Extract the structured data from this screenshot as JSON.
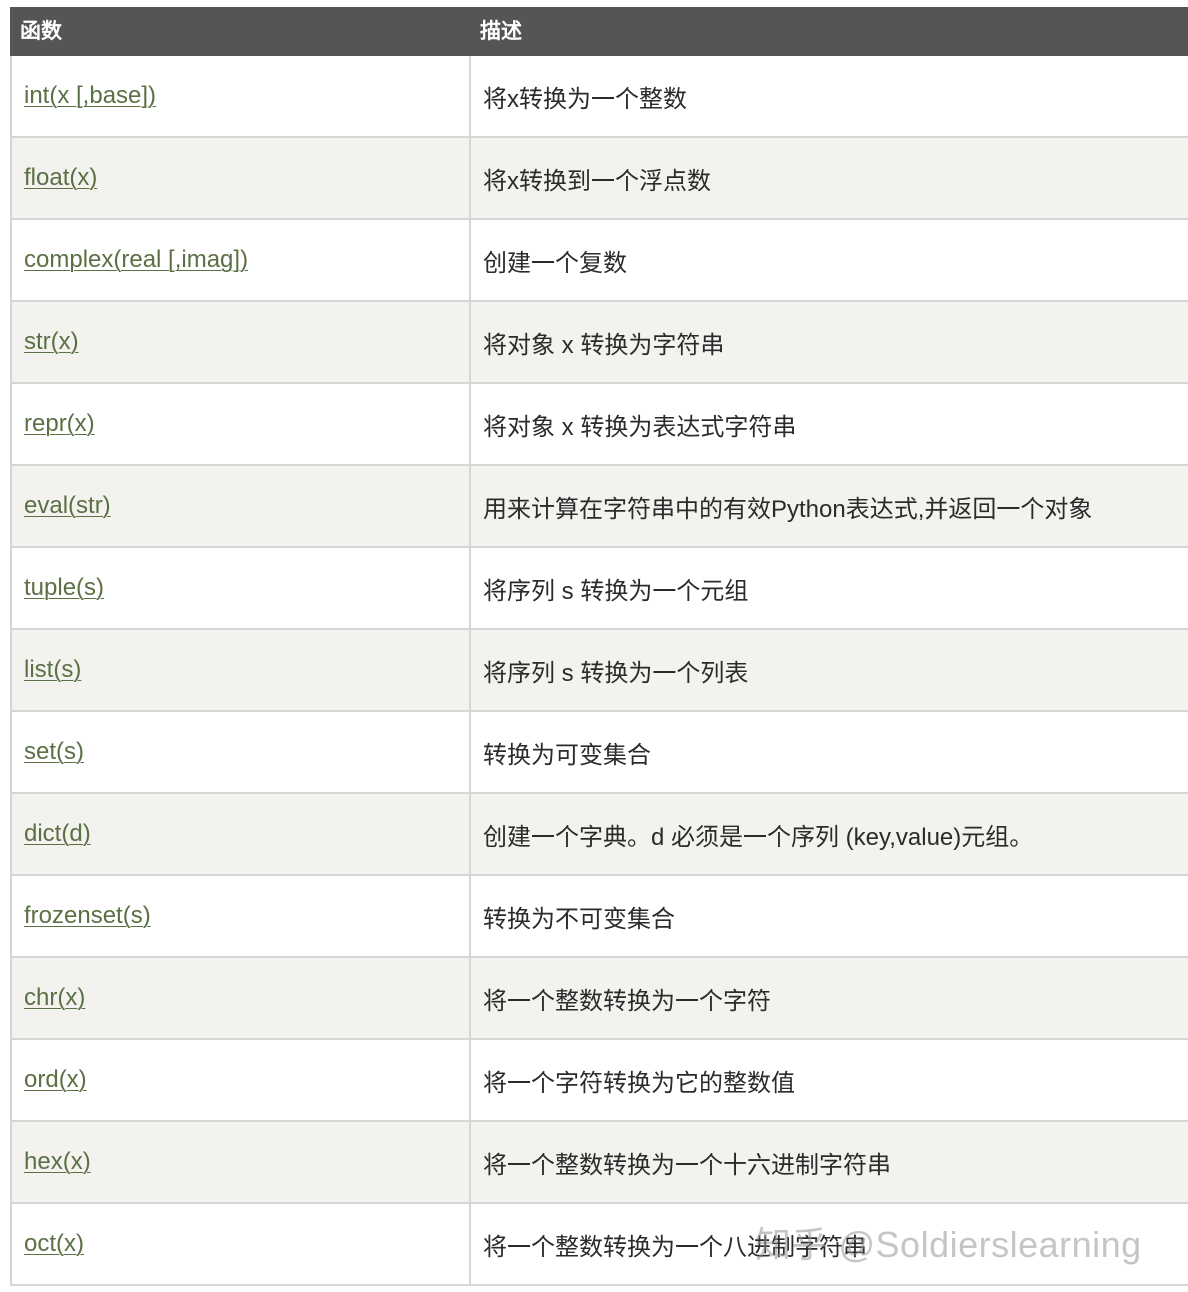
{
  "table": {
    "headers": [
      "函数",
      "描述"
    ],
    "rows": [
      {
        "function": "int(x [,base])",
        "description": "将x转换为一个整数"
      },
      {
        "function": "float(x)",
        "description": "将x转换到一个浮点数"
      },
      {
        "function": "complex(real [,imag])",
        "description": "创建一个复数"
      },
      {
        "function": "str(x)",
        "description": "将对象 x 转换为字符串"
      },
      {
        "function": "repr(x)",
        "description": "将对象 x 转换为表达式字符串"
      },
      {
        "function": "eval(str)",
        "description": "用来计算在字符串中的有效Python表达式,并返回一个对象"
      },
      {
        "function": "tuple(s)",
        "description": "将序列 s 转换为一个元组"
      },
      {
        "function": "list(s)",
        "description": "将序列 s 转换为一个列表"
      },
      {
        "function": "set(s)",
        "description": "转换为可变集合"
      },
      {
        "function": "dict(d)",
        "description": "创建一个字典。d 必须是一个序列 (key,value)元组。"
      },
      {
        "function": "frozenset(s)",
        "description": "转换为不可变集合"
      },
      {
        "function": "chr(x)",
        "description": "将一个整数转换为一个字符"
      },
      {
        "function": "ord(x)",
        "description": "将一个字符转换为它的整数值"
      },
      {
        "function": "hex(x)",
        "description": "将一个整数转换为一个十六进制字符串"
      },
      {
        "function": "oct(x)",
        "description": "将一个整数转换为一个八进制字符串"
      }
    ]
  },
  "watermark": "知乎 @Soldierslearning",
  "colors": {
    "header_bg": "#555555",
    "link": "#5b7043",
    "alt_row": "#f3f2ef"
  }
}
